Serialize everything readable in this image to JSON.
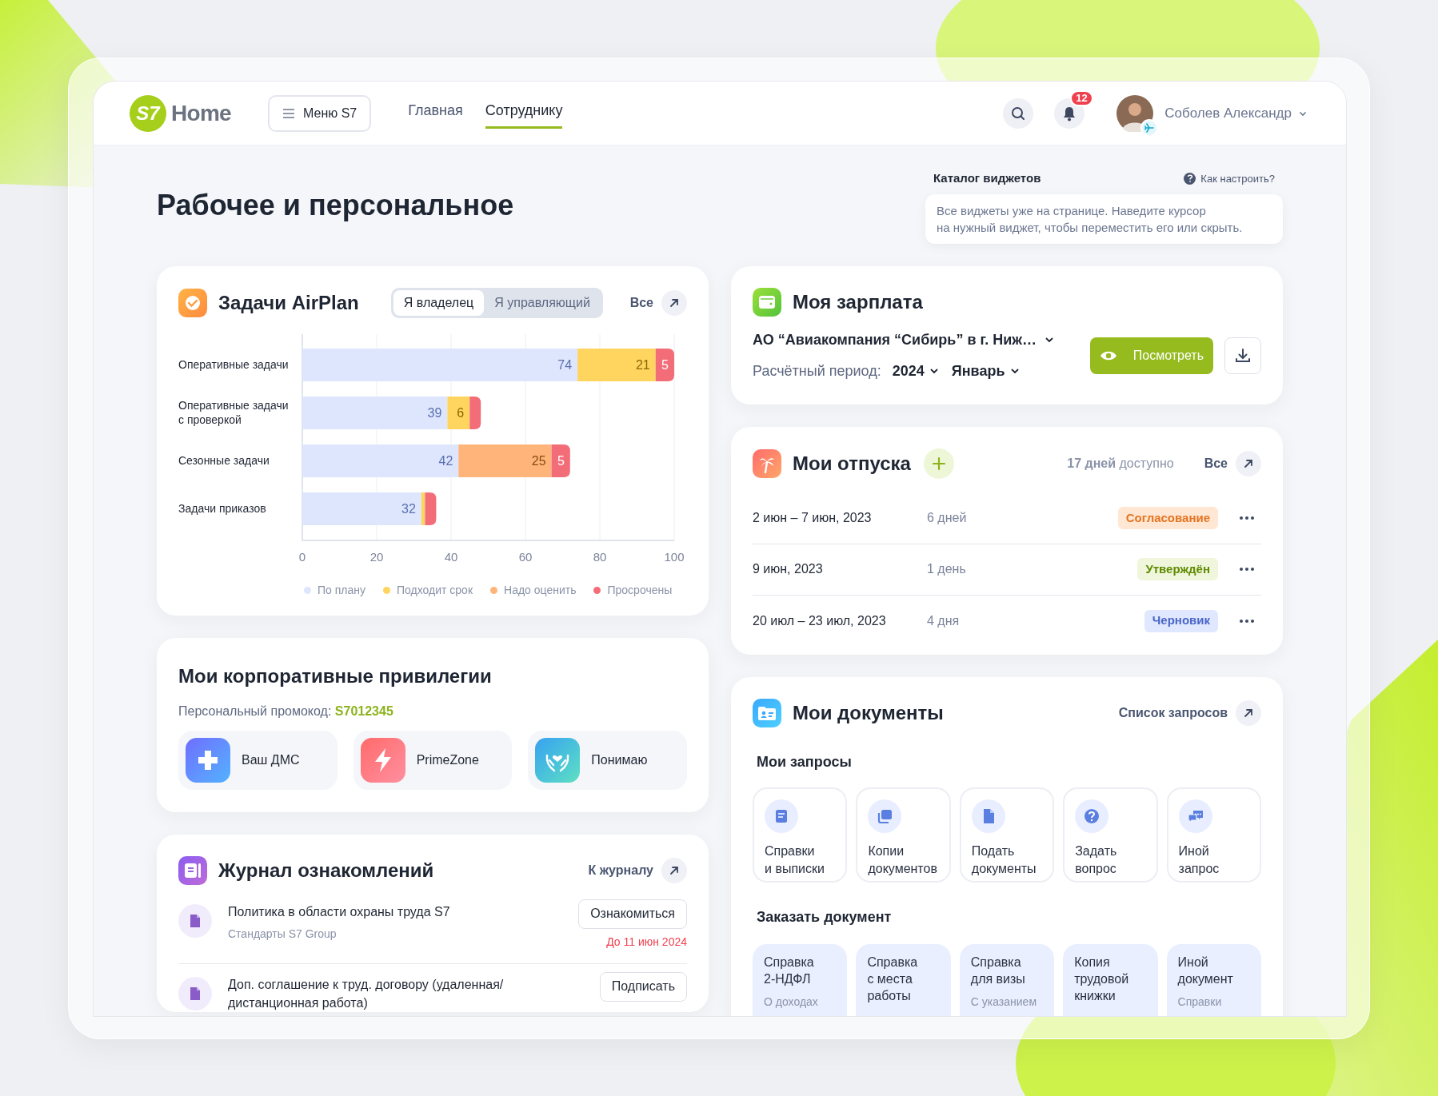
{
  "header": {
    "logo_mark": "S7",
    "logo_text": "Home",
    "menu_button": "Меню S7",
    "nav": [
      {
        "label": "Главная",
        "selected": false
      },
      {
        "label": "Сотруднику",
        "selected": true
      }
    ],
    "notification_count": "12",
    "user_name": "Соболев Александр"
  },
  "page_title": "Рабочее и персональное",
  "widget_catalog": {
    "title": "Каталог виджетов",
    "help_link": "Как настроить?",
    "message": "Все виджеты уже на странице. Наведите курсор\nна нужный виджет, чтобы переместить его или скрыть."
  },
  "airplan": {
    "title": "Задачи AirPlan",
    "toggle": [
      {
        "label": "Я владелец",
        "selected": true
      },
      {
        "label": "Я управляющий",
        "selected": false
      }
    ],
    "all_link": "Все",
    "chart_data": {
      "type": "bar",
      "orientation": "horizontal",
      "stacked": true,
      "grid": true,
      "value_labels": [
        [
          "74",
          "39",
          "42",
          "32"
        ],
        [
          "21",
          "6",
          null,
          null
        ],
        [
          null,
          null,
          "25",
          null
        ],
        [
          "5",
          null,
          "5",
          null
        ]
      ],
      "categories": [
        "Оперативные задачи",
        "Оперативные задачи\nс проверкой",
        "Сезонные задачи",
        "Задачи приказов"
      ],
      "series": [
        {
          "name": "По плану",
          "color": "#dde6fd",
          "values": [
            74,
            39,
            42,
            32
          ]
        },
        {
          "name": "Подходит срок",
          "color": "#ffd45f",
          "values": [
            21,
            6,
            null,
            1
          ]
        },
        {
          "name": "Надо оценить",
          "color": "#ffb57a",
          "values": [
            null,
            null,
            25,
            null
          ]
        },
        {
          "name": "Просрочены",
          "color": "#f26d78",
          "values": [
            5,
            3,
            5,
            3
          ]
        }
      ],
      "xlim": [
        0,
        100
      ],
      "xticks": [
        0,
        20,
        40,
        60,
        80,
        100
      ]
    }
  },
  "privileges": {
    "title": "Мои корпоративные привилегии",
    "promo_label": "Персональный промокод:",
    "promo_code": "S7012345",
    "items": [
      {
        "label": "Ваш ДМС",
        "kind": "medical"
      },
      {
        "label": "PrimeZone",
        "kind": "lightning"
      },
      {
        "label": "Понимаю",
        "kind": "care"
      }
    ]
  },
  "journal": {
    "title": "Журнал ознакомлений",
    "link": "К журналу",
    "items": [
      {
        "title": "Политика в области охраны труда S7",
        "subtitle": "Стандарты S7 Group",
        "action": "Ознакомиться",
        "deadline": "До 11 июн 2024"
      },
      {
        "title": "Доп. соглашение к труд. договору (удаленная/\nдистанционная работа)",
        "action": "Подписать"
      }
    ]
  },
  "salary": {
    "title": "Моя зарплата",
    "company": "АО “Авиакомпания “Сибирь” в г. Ниж…",
    "period_label": "Расчётный период:",
    "year": "2024",
    "month": "Январь",
    "view_button": "Посмотреть"
  },
  "vacations": {
    "title": "Мои отпуска",
    "available": "**17 дней** доступно",
    "all_link": "Все",
    "rows": [
      {
        "dates": "2 июн – 7 июн, 2023",
        "duration": "6 дней",
        "status": "Согласование",
        "kind": "pending"
      },
      {
        "dates": "9 июн, 2023",
        "duration": "1 день",
        "status": "Утверждён",
        "kind": "approved"
      },
      {
        "dates": "20 июл – 23 июл, 2023",
        "duration": "4 дня",
        "status": "Черновик",
        "kind": "draft"
      }
    ]
  },
  "documents": {
    "title": "Мои документы",
    "link": "Список запросов",
    "requests_title": "Мои запросы",
    "requests": [
      {
        "label": "Справки\nи выписки",
        "kind": "statement"
      },
      {
        "label": "Копии\nдокументов",
        "kind": "copies"
      },
      {
        "label": "Подать\nдокументы",
        "kind": "file"
      },
      {
        "label": "Задать\nвопрос",
        "kind": "question"
      },
      {
        "label": "Иной\nзапрос",
        "kind": "chat"
      }
    ],
    "order_title": "Заказать документ",
    "orders": [
      {
        "title": "Справка\n2-НДФЛ",
        "subtitle": "О доходах"
      },
      {
        "title": "Справка\nс места\nработы"
      },
      {
        "title": "Справка\nдля визы",
        "subtitle": "С указанием"
      },
      {
        "title": "Копия\nтрудовой\nкнижки"
      },
      {
        "title": "Иной\nдокумент",
        "subtitle": "Справки"
      }
    ]
  }
}
